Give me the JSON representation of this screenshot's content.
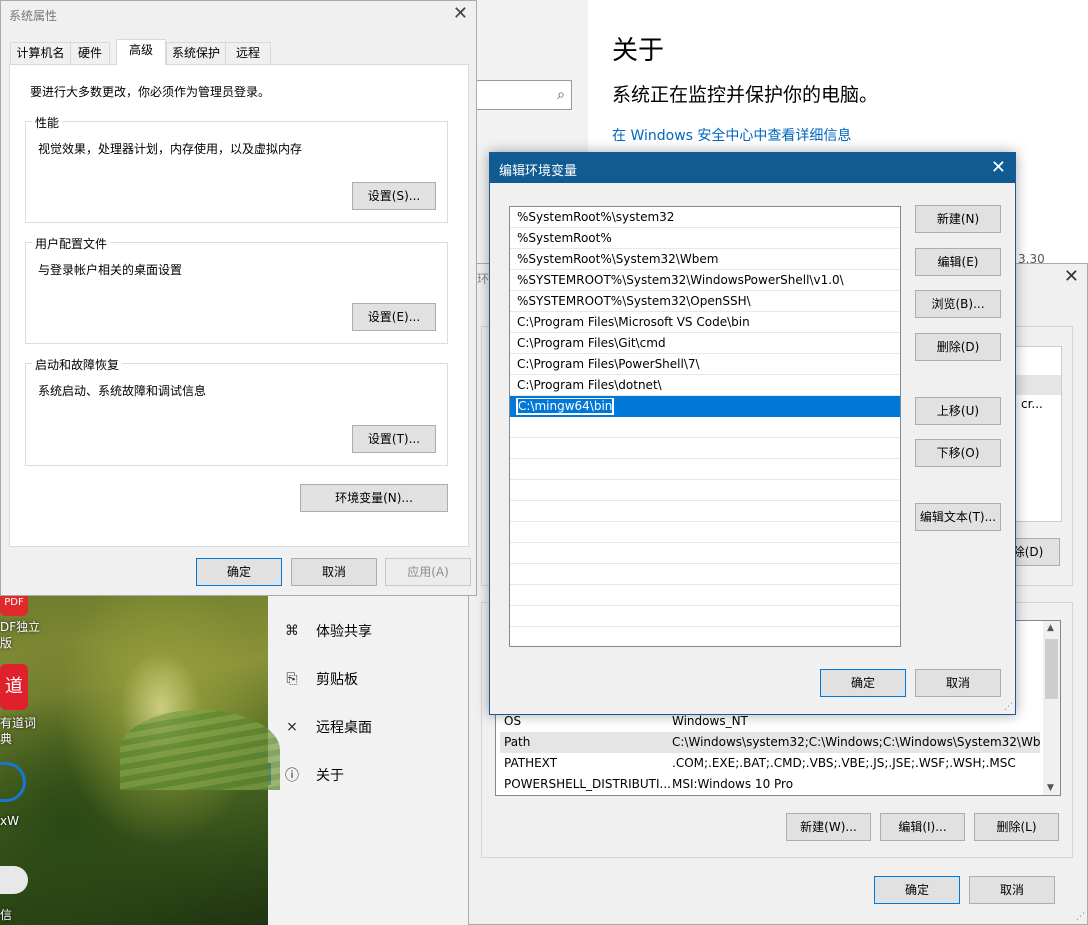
{
  "settings": {
    "about_title": "关于",
    "status_text": "系统正在监控并保护你的电脑。",
    "security_link": "在 Windows 安全中心中查看详细信息",
    "version_fragment": "3.30",
    "nav": [
      {
        "label": "体验共享",
        "icon": "share-icon"
      },
      {
        "label": "剪贴板",
        "icon": "clipboard-icon"
      },
      {
        "label": "远程桌面",
        "icon": "remote-desktop-icon"
      },
      {
        "label": "关于",
        "icon": "info-icon"
      }
    ]
  },
  "desktop": {
    "icons": [
      {
        "label_lines": [
          "DF独立",
          "版"
        ],
        "badge": "PDF",
        "color": "#e0292b"
      },
      {
        "label_lines": [
          "有道词",
          "典"
        ],
        "badge": "道",
        "color": "#e0202b"
      },
      {
        "label_lines": [
          "xW"
        ],
        "badge": "",
        "color": "#1976d2"
      },
      {
        "label_lines": [
          "信"
        ],
        "badge": "",
        "color": "#2aae67"
      }
    ]
  },
  "sysprops": {
    "title": "系统属性",
    "tabs": [
      "计算机名",
      "硬件",
      "高级",
      "系统保护",
      "远程"
    ],
    "active_tab": "高级",
    "admin_notice": "要进行大多数更改，你必须作为管理员登录。",
    "performance": {
      "legend": "性能",
      "desc": "视觉效果，处理器计划，内存使用，以及虚拟内存",
      "button": "设置(S)..."
    },
    "user_profiles": {
      "legend": "用户配置文件",
      "desc": "与登录帐户相关的桌面设置",
      "button": "设置(E)..."
    },
    "startup": {
      "legend": "启动和故障恢复",
      "desc": "系统启动、系统故障和调试信息",
      "button": "设置(T)..."
    },
    "env_button": "环境变量(N)...",
    "ok": "确定",
    "cancel": "取消",
    "apply": "应用(A)"
  },
  "envvars": {
    "title_fragment": "环",
    "user_delete_fragment": "除(D)",
    "user_row_fragment": "cr...",
    "system_vars": [
      {
        "name": "OS",
        "value": "Windows_NT"
      },
      {
        "name": "Path",
        "value": "C:\\Windows\\system32;C:\\Windows;C:\\Windows\\System32\\Wb..."
      },
      {
        "name": "PATHEXT",
        "value": ".COM;.EXE;.BAT;.CMD;.VBS;.VBE;.JS;.JSE;.WSF;.WSH;.MSC"
      },
      {
        "name": "POWERSHELL_DISTRIBUTI...",
        "value": "MSI:Windows 10 Pro"
      }
    ],
    "new_button": "新建(W)...",
    "edit_button": "编辑(I)...",
    "delete_button": "删除(L)",
    "ok": "确定",
    "cancel": "取消"
  },
  "edit_dialog": {
    "title": "编辑环境变量",
    "paths": [
      "%SystemRoot%\\system32",
      "%SystemRoot%",
      "%SystemRoot%\\System32\\Wbem",
      "%SYSTEMROOT%\\System32\\WindowsPowerShell\\v1.0\\",
      "%SYSTEMROOT%\\System32\\OpenSSH\\",
      "C:\\Program Files\\Microsoft VS Code\\bin",
      "C:\\Program Files\\Git\\cmd",
      "C:\\Program Files\\PowerShell\\7\\",
      "C:\\Program Files\\dotnet\\"
    ],
    "editing_value": "C:\\mingw64\\bin",
    "buttons": {
      "new": "新建(N)",
      "edit": "编辑(E)",
      "browse": "浏览(B)...",
      "delete": "删除(D)",
      "move_up": "上移(U)",
      "move_down": "下移(O)",
      "edit_text": "编辑文本(T)..."
    },
    "ok": "确定",
    "cancel": "取消"
  }
}
